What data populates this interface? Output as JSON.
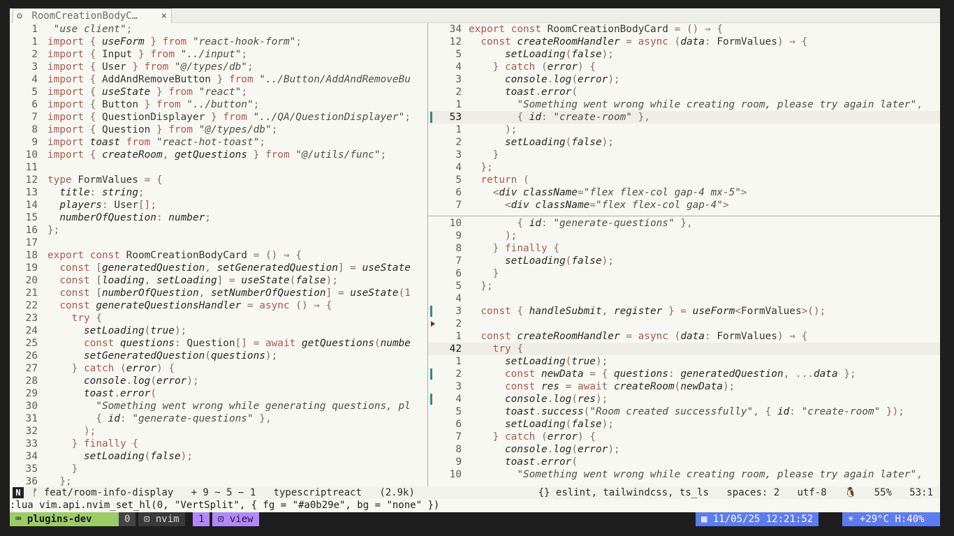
{
  "tab": {
    "icon": "gear-icon",
    "title": "RoomCreationBodyC…",
    "close": "×"
  },
  "left_pane": [
    {
      "n": "1",
      "t": " \"use client\";",
      "c": "s"
    },
    {
      "n": "1",
      "t": "import { useForm } from \"react-hook-form\";"
    },
    {
      "n": "2",
      "t": "import { Input } from \"../input\";"
    },
    {
      "n": "3",
      "t": "import { User } from \"@/types/db\";"
    },
    {
      "n": "4",
      "t": "import { AddAndRemoveButton } from \"../Button/AddAndRemoveBu"
    },
    {
      "n": "5",
      "t": "import { useState } from \"react\";"
    },
    {
      "n": "6",
      "t": "import { Button } from \"../button\";"
    },
    {
      "n": "7",
      "t": "import { QuestionDisplayer } from \"../QA/QuestionDisplayer\";"
    },
    {
      "n": "8",
      "t": "import { Question } from \"@/types/db\";"
    },
    {
      "n": "9",
      "t": "import toast from \"react-hot-toast\";"
    },
    {
      "n": "10",
      "t": "import { createRoom, getQuestions } from \"@/utils/func\";"
    },
    {
      "n": "11",
      "t": ""
    },
    {
      "n": "12",
      "t": "type FormValues = {"
    },
    {
      "n": "13",
      "t": "  title: string;"
    },
    {
      "n": "14",
      "t": "  players: User[];"
    },
    {
      "n": "15",
      "t": "  numberOfQuestion: number;"
    },
    {
      "n": "16",
      "t": "};"
    },
    {
      "n": "17",
      "t": ""
    },
    {
      "n": "18",
      "t": "export const RoomCreationBodyCard = () ⇒ {"
    },
    {
      "n": "19",
      "t": "  const [generatedQuestion, setGeneratedQuestion] = useState"
    },
    {
      "n": "20",
      "t": "  const [loading, setLoading] = useState(false);"
    },
    {
      "n": "21",
      "t": "  const [numberOfQuestion, setNumberOfQuestion] = useState(1"
    },
    {
      "n": "22",
      "t": "  const generateQuestionsHandler = async () ⇒ {"
    },
    {
      "n": "23",
      "t": "    try {"
    },
    {
      "n": "24",
      "t": "      setLoading(true);"
    },
    {
      "n": "25",
      "t": "      const questions: Question[] = await getQuestions(numbe"
    },
    {
      "n": "26",
      "t": "      setGeneratedQuestion(questions);"
    },
    {
      "n": "27",
      "t": "    } catch (error) {"
    },
    {
      "n": "28",
      "t": "      console.log(error);"
    },
    {
      "n": "29",
      "t": "      toast.error("
    },
    {
      "n": "30",
      "t": "        \"Something went wrong while generating questions, pl"
    },
    {
      "n": "31",
      "t": "        { id: \"generate-questions\" },"
    },
    {
      "n": "32",
      "t": "      );"
    },
    {
      "n": "33",
      "t": "    } finally {"
    },
    {
      "n": "34",
      "t": "      setLoading(false);"
    },
    {
      "n": "35",
      "t": "    }"
    },
    {
      "n": "36",
      "t": "  };"
    }
  ],
  "right_top_pane": [
    {
      "n": "34",
      "t": "export const RoomCreationBodyCard = () ⇒ {"
    },
    {
      "n": "12",
      "t": "  const createRoomHandler = async (data: FormValues) ⇒ {"
    },
    {
      "n": "5",
      "t": "      setLoading(false);"
    },
    {
      "n": "4",
      "t": "    } catch (error) {"
    },
    {
      "n": "3",
      "t": "      console.log(error);"
    },
    {
      "n": "2",
      "t": "      toast.error("
    },
    {
      "n": "1",
      "t": "        \"Something went wrong while creating room, please try again later\","
    },
    {
      "n": "53",
      "t": "        { id: \"create-room\" },",
      "cur": true
    },
    {
      "n": "1",
      "t": "      );"
    },
    {
      "n": "2",
      "t": "      setLoading(false);"
    },
    {
      "n": "3",
      "t": "    }"
    },
    {
      "n": "4",
      "t": "  };"
    },
    {
      "n": "5",
      "t": "  return ("
    },
    {
      "n": "6",
      "t": "    <div className=\"flex flex-col gap-4 mx-5\">"
    },
    {
      "n": "7",
      "t": "      <div className=\"flex flex-col gap-4\">"
    }
  ],
  "right_bottom_pane": [
    {
      "n": "10",
      "t": "        { id: \"generate-questions\" },"
    },
    {
      "n": "9",
      "t": "      );"
    },
    {
      "n": "8",
      "t": "    } finally {"
    },
    {
      "n": "7",
      "t": "      setLoading(false);"
    },
    {
      "n": "6",
      "t": "    }"
    },
    {
      "n": "5",
      "t": "  };"
    },
    {
      "n": "4",
      "t": ""
    },
    {
      "n": "3",
      "t": "  const { handleSubmit, register } = useForm<FormValues>();"
    },
    {
      "n": "2",
      "t": ""
    },
    {
      "n": "1",
      "t": "  const createRoomHandler = async (data: FormValues) ⇒ {"
    },
    {
      "n": "42",
      "t": "    try {",
      "cur": true
    },
    {
      "n": "1",
      "t": "      setLoading(true);"
    },
    {
      "n": "2",
      "t": "      const newData = { questions: generatedQuestion, ...data };"
    },
    {
      "n": "3",
      "t": "      const res = await createRoom(newData);"
    },
    {
      "n": "4",
      "t": "      console.log(res);"
    },
    {
      "n": "5",
      "t": "      toast.success(\"Room created successfully\", { id: \"create-room\" });"
    },
    {
      "n": "6",
      "t": "      setLoading(false);"
    },
    {
      "n": "7",
      "t": "    } catch (error) {"
    },
    {
      "n": "8",
      "t": "      console.log(error);"
    },
    {
      "n": "9",
      "t": "      toast.error("
    },
    {
      "n": "10",
      "t": "        \"Something went wrong while creating room, please try again later\","
    }
  ],
  "statusline": {
    "mode": "N",
    "branch": "ᚠ feat/room-info-display",
    "diff": "+ 9 ~ 5 − 1",
    "filetype": "typescriptreact",
    "size": "(2.9k)",
    "lsp": "{} eslint, tailwindcss, ts_ls",
    "spaces": "spaces: 2",
    "encoding": "utf-8",
    "os": "🐧",
    "percent": "55%",
    "position": "53:1"
  },
  "cmdline": ":lua vim.api.nvim_set_hl(0, \"VertSplit\", { fg = \"#a0b29e\", bg = \"none\" })",
  "tmux": {
    "session": "plugins-dev",
    "win0": "0",
    "win0_name": "nvim",
    "win1": "1",
    "win1_name": "view",
    "datetime": "11/05/25 12:21:52",
    "weather": "+29°C H:40%"
  },
  "colors": {
    "vertsplit": "#a0b29e",
    "keyword": "#b0574a",
    "session_bg": "#9ccc65",
    "window_bg": "#b388ff",
    "right_status_bg": "#5c7cf0"
  }
}
